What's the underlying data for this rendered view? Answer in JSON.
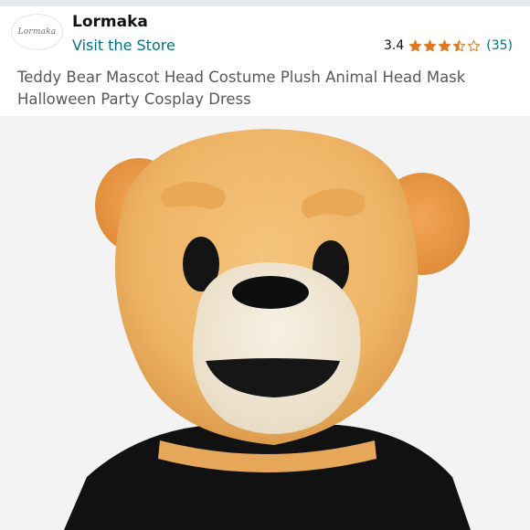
{
  "store": {
    "logo_text": "Lormaka",
    "name": "Lormaka",
    "visit_label": "Visit the Store"
  },
  "rating": {
    "value": "3.4",
    "stars": 3.4,
    "count": "(35)",
    "star_color": "#de7921",
    "star_outline_color": "#de7921"
  },
  "product": {
    "title": "Teddy Bear Mascot Head Costume Plush Animal Head Mask Halloween Party Cosplay Dress",
    "image_icon": "teddy-bear-mascot-head"
  },
  "colors": {
    "link": "#007185",
    "fur": "#eeb466",
    "muzzle": "#f2e8d7",
    "shirt": "#111111"
  }
}
